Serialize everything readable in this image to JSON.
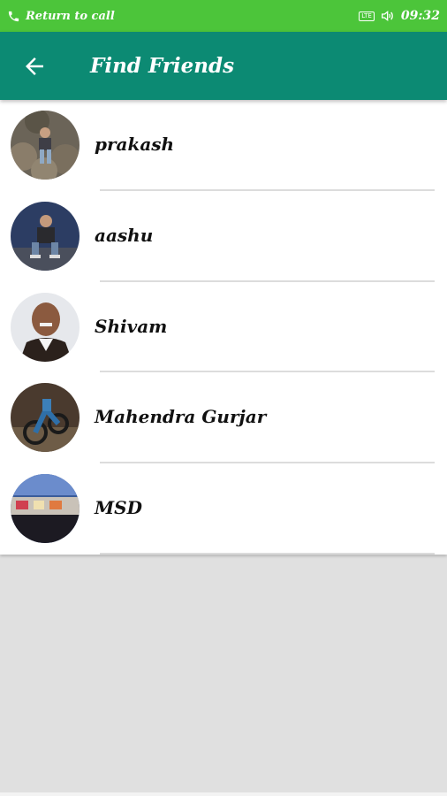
{
  "status_bar": {
    "call_text": "Return to call",
    "network_badge": "LTE",
    "time": "09:32",
    "icons": [
      "phone-icon",
      "lte-icon",
      "volume-icon"
    ],
    "color": "#4cc53a"
  },
  "app_bar": {
    "title": "Find Friends",
    "back_icon": "arrow-back-icon",
    "color": "#0c8a73"
  },
  "friends": [
    {
      "name": "prakash",
      "avatar": "photo-man-sitting-on-rocks"
    },
    {
      "name": "aashu",
      "avatar": "photo-man-sitting-outdoors"
    },
    {
      "name": "Shivam",
      "avatar": "photo-man-smiling-portrait"
    },
    {
      "name": "Mahendra Gurjar",
      "avatar": "photo-motorcycle"
    },
    {
      "name": "MSD",
      "avatar": "photo-building-at-dusk"
    }
  ]
}
